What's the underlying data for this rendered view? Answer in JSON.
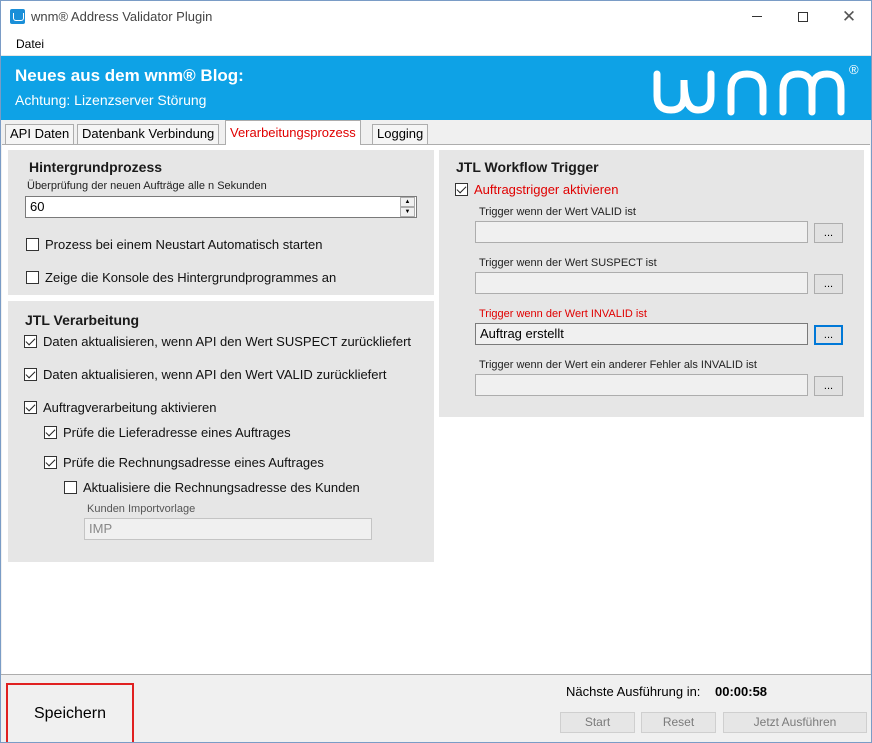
{
  "window": {
    "title": "wnm® Address Validator Plugin",
    "controls": {
      "minimize": "—",
      "maximize": "☐",
      "close": "✕"
    }
  },
  "menu": {
    "items": [
      "Datei"
    ]
  },
  "banner": {
    "title": "Neues aus dem wnm® Blog:",
    "subtitle": "Achtung: Lizenzserver Störung",
    "logo_text": "wnm",
    "logo_mark": "®",
    "accent_color": "#0ea2e6"
  },
  "tabs": [
    {
      "label": "API Daten"
    },
    {
      "label": "Datenbank Verbindung"
    },
    {
      "label": "Verarbeitungsprozess"
    },
    {
      "label": "Logging"
    }
  ],
  "active_tab": "Verarbeitungsprozess",
  "background": {
    "title": "Hintergrundprozess",
    "interval_label": "Überprüfung der neuen Aufträge alle n Sekunden",
    "interval_value": "60",
    "autostart_label": "Prozess bei einem Neustart Automatisch starten",
    "autostart_checked": false,
    "console_label": "Zeige die Konsole des Hintergrundprogrammes an",
    "console_checked": false
  },
  "jtl_processing": {
    "title": "JTL Verarbeitung",
    "update_suspect_label": "Daten aktualisieren, wenn API den Wert SUSPECT zurückliefert",
    "update_suspect_checked": true,
    "update_valid_label": "Daten aktualisieren, wenn API den Wert VALID zurückliefert",
    "update_valid_checked": true,
    "order_processing_label": "Auftragverarbeitung aktivieren",
    "order_processing_checked": true,
    "check_delivery_label": "Prüfe die Lieferadresse eines Auftrages",
    "check_delivery_checked": true,
    "check_billing_label": "Prüfe die Rechnungsadresse eines Auftrages",
    "check_billing_checked": true,
    "update_customer_billing_label": "Aktualisiere die Rechnungsadresse des Kunden",
    "update_customer_billing_checked": false,
    "import_template_label": "Kunden Importvorlage",
    "import_template_value": "IMP"
  },
  "workflow": {
    "title": "JTL Workflow Trigger",
    "enable_label": "Auftragstrigger aktivieren",
    "enable_checked": true,
    "valid_label": "Trigger wenn der Wert VALID ist",
    "valid_value": "",
    "suspect_label": "Trigger wenn der Wert SUSPECT ist",
    "suspect_value": "",
    "invalid_label": "Trigger wenn der Wert INVALID ist",
    "invalid_value": "Auftrag erstellt",
    "other_label": "Trigger wenn der Wert ein anderer Fehler als INVALID ist",
    "other_value": "",
    "browse_label": "..."
  },
  "footer": {
    "save_label": "Speichern",
    "next_run_label": "Nächste Ausführung in:",
    "next_run_value": "00:00:58",
    "start_label": "Start",
    "reset_label": "Reset",
    "run_now_label": "Jetzt Ausführen"
  }
}
